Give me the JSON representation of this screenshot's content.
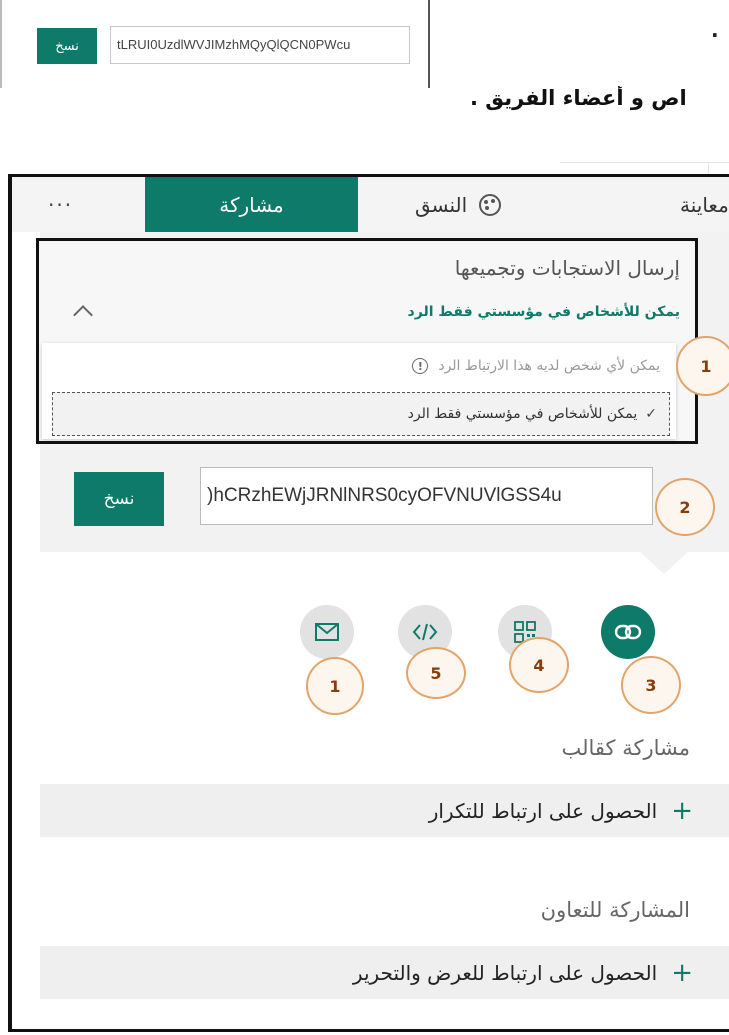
{
  "top_snippet": {
    "copy_label": "نسخ",
    "link_value": "tLRUI0UzdlWVJIMzhMQyQlQCN0PWcu",
    "dot": ".",
    "heading": "اص و أعضاء الفريق ."
  },
  "tabs": {
    "more": "···",
    "share": "مشاركة",
    "style": "النسق",
    "preview": "معاينة"
  },
  "send": {
    "title": "إرسال الاستجابات وتجميعها",
    "selected_permission": "يمكن للأشخاص في مؤسستي فقط الرد",
    "options": {
      "anyone": "يمكن لأي شخص لديه هذا الارتباط الرد",
      "org": "يمكن للأشخاص في مؤسستي فقط الرد"
    },
    "info_glyph": "!",
    "check_glyph": "✓"
  },
  "link": {
    "copy_label": "نسخ",
    "value": ")hCRzhEWjJRNlNRS0cyOFVNUVlGSS4u"
  },
  "methods": [
    "email-icon",
    "embed-code-icon",
    "qr-code-icon",
    "link-icon"
  ],
  "markers": {
    "n1a": "1",
    "n2": "2",
    "n1b": "1",
    "n5": "5",
    "n4": "4",
    "n3": "3"
  },
  "template": {
    "title": "مشاركة كقالب",
    "action": "الحصول على ارتباط للتكرار"
  },
  "collab": {
    "title": "المشاركة للتعاون",
    "action": "الحصول على ارتباط للعرض والتحرير"
  },
  "plus_glyph": "+",
  "colors": {
    "accent": "#0e7a6a",
    "marker_border": "#e2a46a",
    "marker_text": "#8a3b0a"
  }
}
